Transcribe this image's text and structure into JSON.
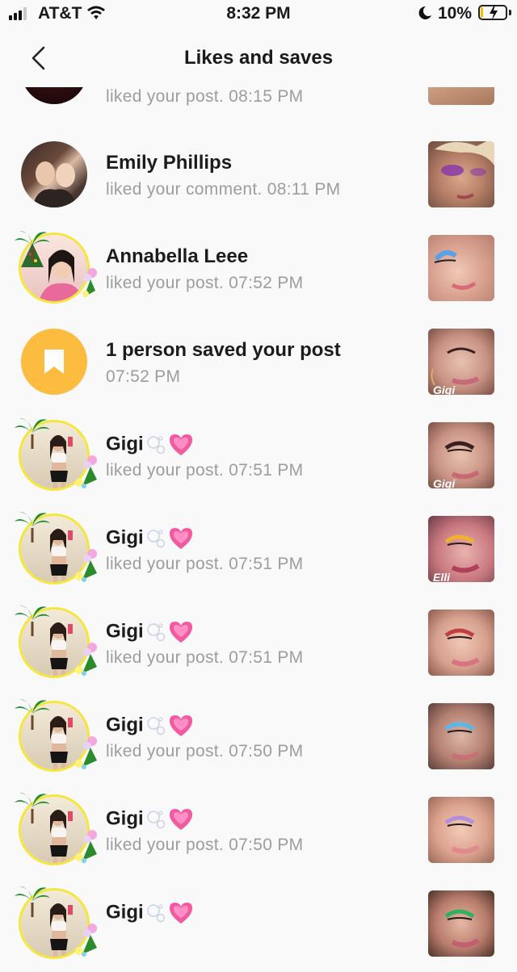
{
  "status_bar": {
    "carrier": "AT&T",
    "time": "8:32 PM",
    "battery_percent": "10%",
    "battery_level": 0.1,
    "signal_bars_filled": 3
  },
  "nav": {
    "title": "Likes and saves",
    "back_icon": "chevron-left-icon"
  },
  "colors": {
    "saved_badge": "#fcbc3f",
    "muted_text": "#9d9d9d",
    "ring": "#f4e63a"
  },
  "notifications": [
    {
      "name": "",
      "text": "liked your post. 08:15 PM",
      "avatar": "photo-dark"
    },
    {
      "name": "Emily Phillips",
      "text": "liked your comment. 08:11 PM",
      "avatar": "photo-two-girls"
    },
    {
      "name": "Annabella Leee",
      "text": "liked your post. 07:52 PM",
      "avatar": "photo-palm-frame"
    },
    {
      "name": "1 person saved your post",
      "text": "07:52 PM",
      "avatar": "bookmark-icon"
    },
    {
      "name": "Gigi",
      "text": "liked your post. 07:51 PM",
      "avatar": "photo-palm-frame",
      "thumb_caption": "Gigi"
    },
    {
      "name": "Gigi",
      "text": "liked your post. 07:51 PM",
      "avatar": "photo-palm-frame",
      "thumb_caption": "Elli"
    },
    {
      "name": "Gigi",
      "text": "liked your post. 07:51 PM",
      "avatar": "photo-palm-frame"
    },
    {
      "name": "Gigi",
      "text": "liked your post. 07:50 PM",
      "avatar": "photo-palm-frame"
    },
    {
      "name": "Gigi",
      "text": "liked your post. 07:50 PM",
      "avatar": "photo-palm-frame"
    },
    {
      "name": "Gigi",
      "text": "",
      "avatar": "photo-palm-frame"
    }
  ]
}
